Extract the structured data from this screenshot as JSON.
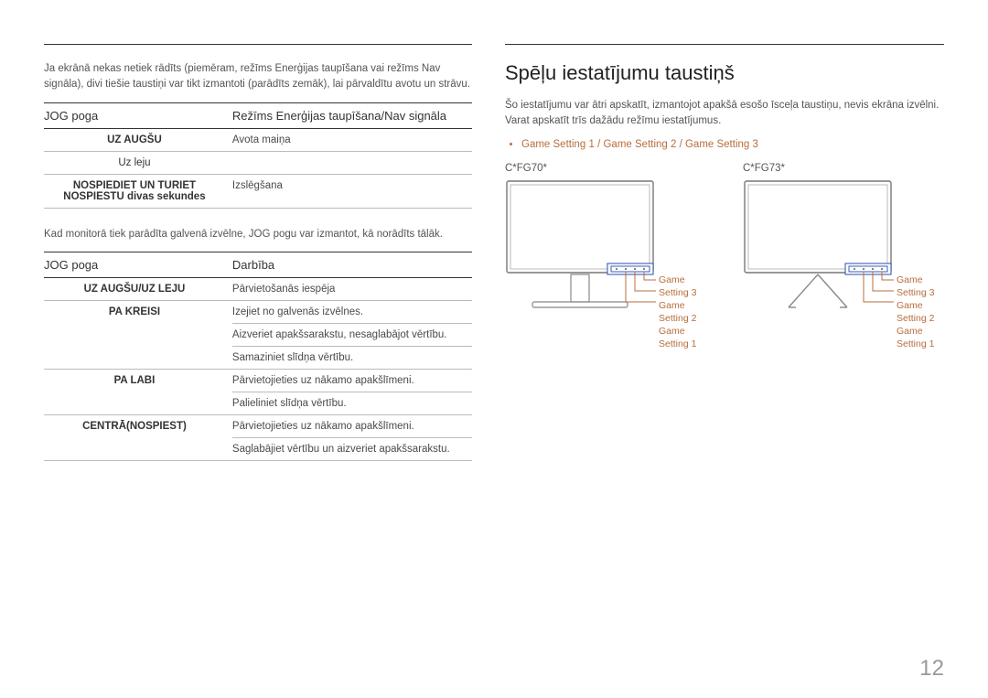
{
  "left": {
    "intro": "Ja ekrānā nekas netiek rādīts (piemēram, režīms Enerģijas taupīšana vai režīms Nav signāla), divi tiešie taustiņi var tikt izmantoti (parādīts zemāk), lai pārvaldītu avotu un strāvu.",
    "table1": {
      "headers": [
        "JOG poga",
        "Režīms Enerģijas taupīšana/Nav signāla"
      ],
      "rows": [
        [
          "UZ AUGŠU",
          "Avota maiņa"
        ],
        [
          "Uz leju",
          ""
        ],
        [
          "NOSPIEDIET UN TURIET NOSPIESTU divas sekundes",
          "Izslēgšana"
        ]
      ]
    },
    "mid_text": "Kad monitorā tiek parādīta galvenā izvēlne, JOG pogu var izmantot, kā norādīts tālāk.",
    "table2": {
      "headers": [
        "JOG poga",
        "Darbība"
      ],
      "rows": [
        {
          "key": "UZ AUGŠU/UZ LEJU",
          "vals": [
            "Pārvietošanās iespēja"
          ]
        },
        {
          "key": "",
          "vals": [
            "Izejiet no galvenās izvēlnes."
          ]
        },
        {
          "key": "PA KREISI",
          "vals": [
            "Aizveriet apakšsarakstu, nesaglabājot vērtību.",
            "Samaziniet slīdņa vērtību."
          ]
        },
        {
          "key": "PA LABI",
          "vals": [
            "Pārvietojieties uz nākamo apakšlīmeni.",
            "Palieliniet slīdņa vērtību."
          ]
        },
        {
          "key": "CENTRĀ(NOSPIEST)",
          "vals": [
            "Pārvietojieties uz nākamo apakšlīmeni.",
            "Saglabājiet vērtību un aizveriet apakšsarakstu."
          ]
        }
      ]
    }
  },
  "right": {
    "title": "Spēļu iestatījumu taustiņš",
    "intro": "Šo iestatījumu var ātri apskatīt, izmantojot apakšā esošo īsceļa taustiņu, nevis ekrāna izvēlni. Varat apskatīt trīs dažādu režīmu iestatījumus.",
    "bullet": "Game Setting 1 / Game Setting 2 / Game Setting 3",
    "models": [
      {
        "label": "C*FG70*",
        "gs": [
          "Game Setting 3",
          "Game Setting 2",
          "Game Setting 1"
        ]
      },
      {
        "label": "C*FG73*",
        "gs": [
          "Game Setting 3",
          "Game Setting 2",
          "Game Setting 1"
        ]
      }
    ]
  },
  "page_number": "12"
}
